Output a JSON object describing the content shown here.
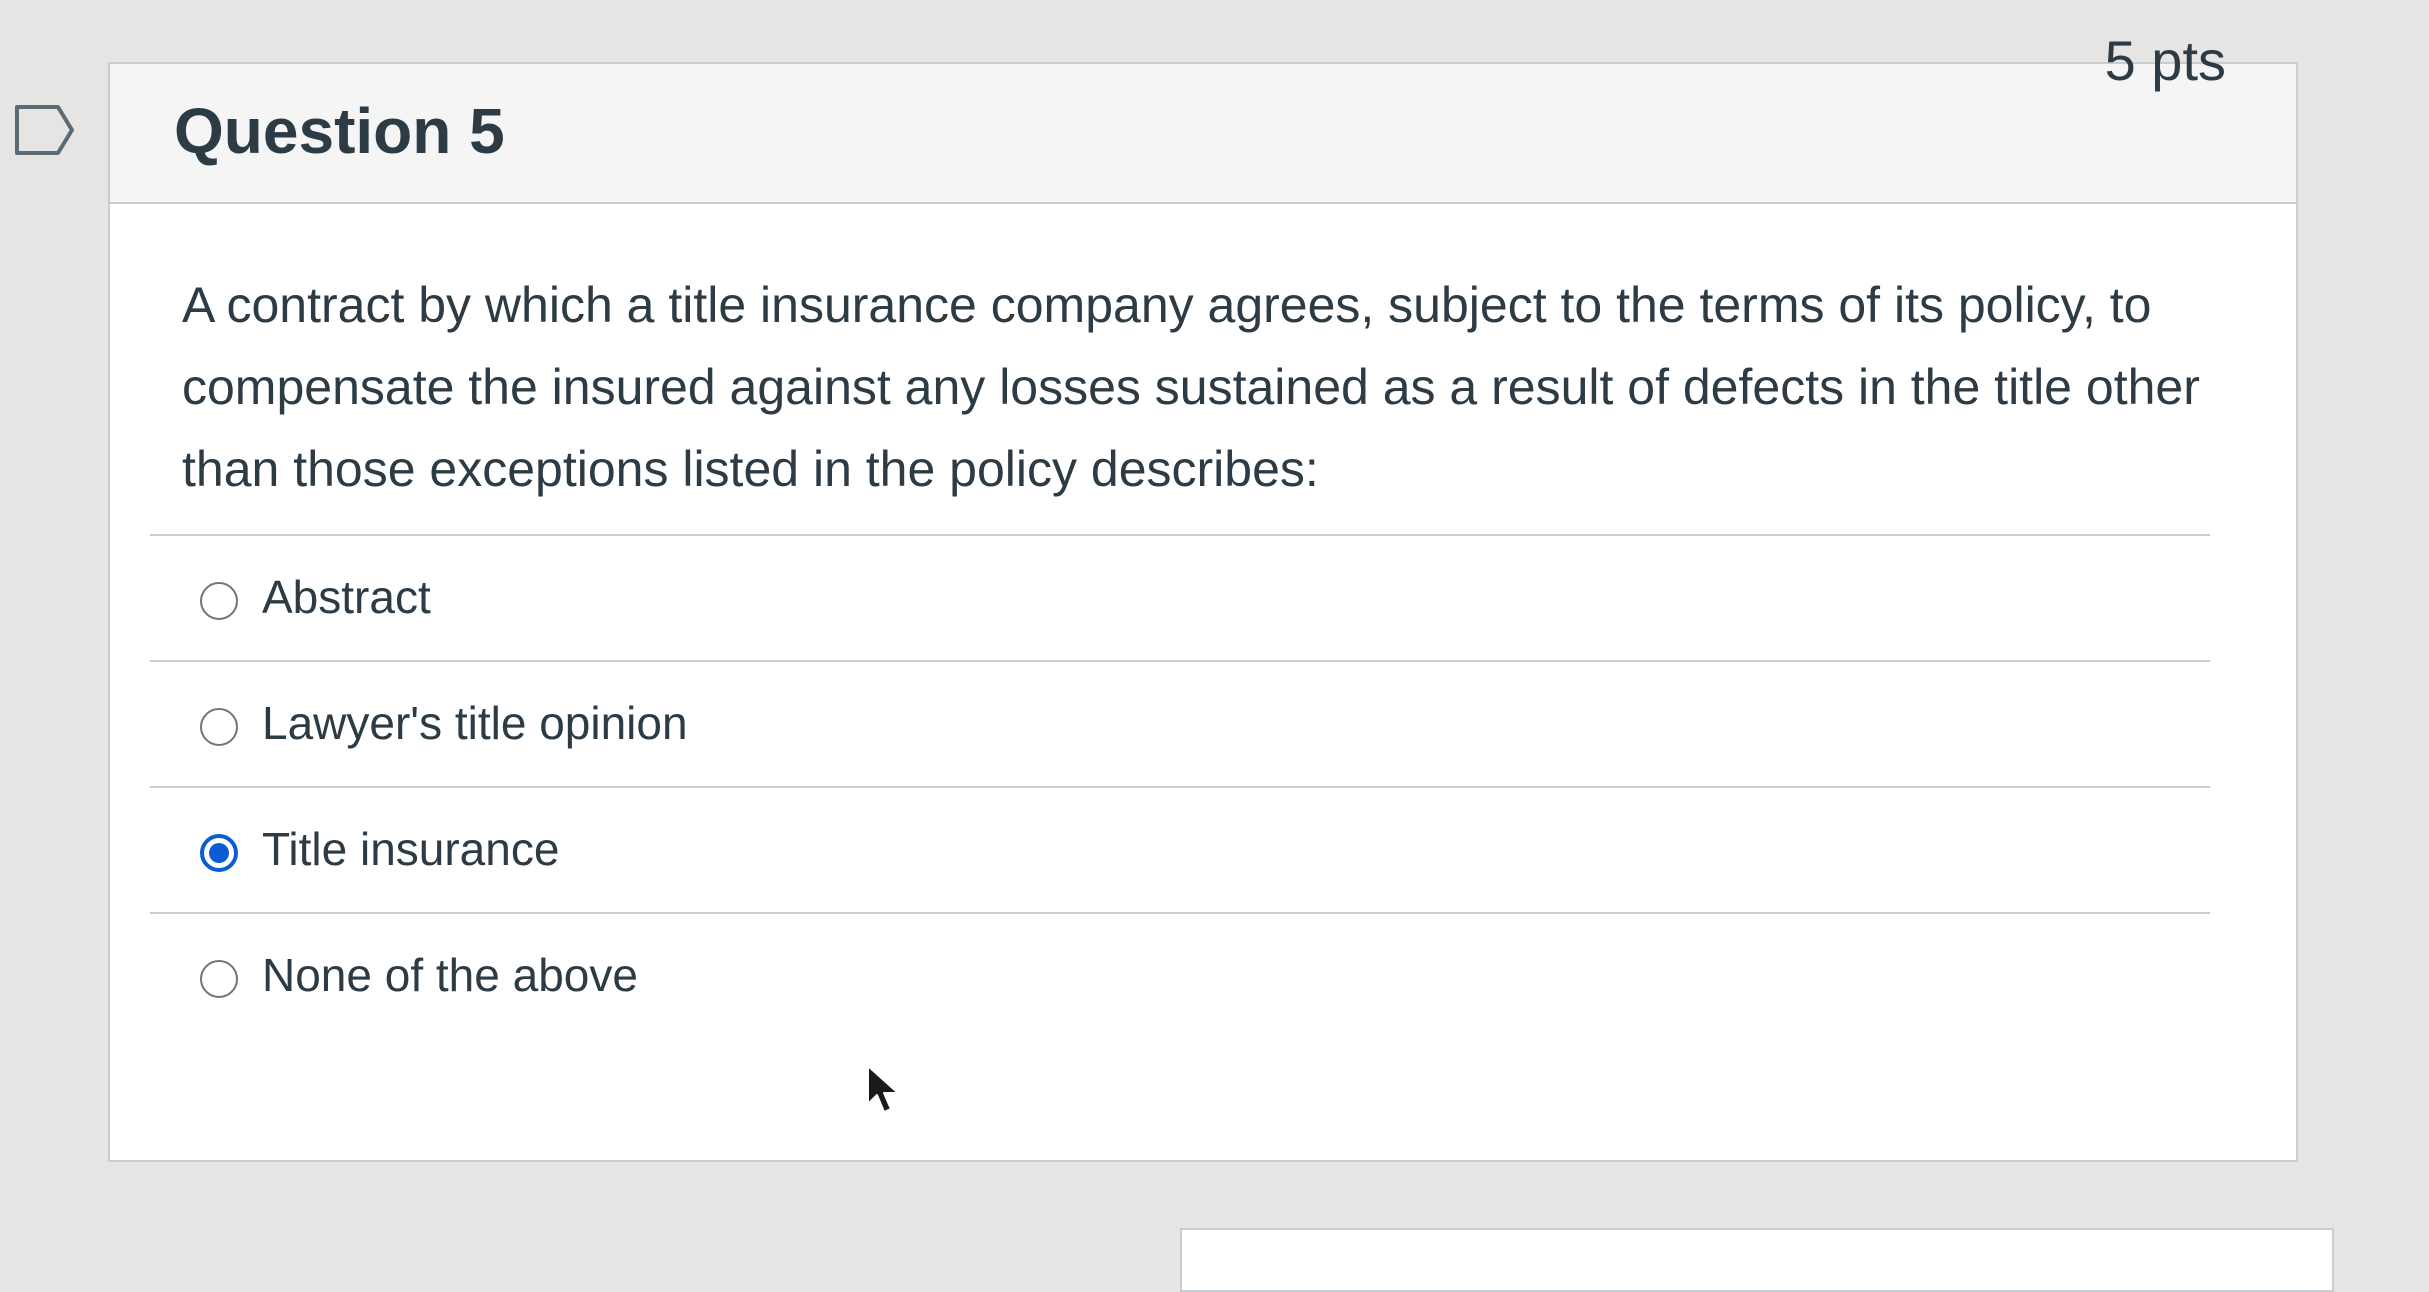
{
  "question": {
    "title": "Question 5",
    "points": "5 pts",
    "text": "A contract by which a title insurance company agrees, subject to the terms of its policy, to compensate the insured against any losses sustained as a result of defects in the title other than those exceptions listed in the policy describes:",
    "answers": [
      {
        "label": "Abstract",
        "selected": false
      },
      {
        "label": "Lawyer's title opinion",
        "selected": false
      },
      {
        "label": "Title insurance",
        "selected": true
      },
      {
        "label": "None of the above",
        "selected": false
      }
    ]
  },
  "icons": {
    "flag": "flag-icon",
    "radio": "radio-button-icon",
    "cursor": "mouse-pointer-icon"
  },
  "colors": {
    "accent": "#0b5cd5",
    "text": "#2d3b45",
    "border": "#c7cdd1",
    "header_bg": "#f5f5f5"
  }
}
